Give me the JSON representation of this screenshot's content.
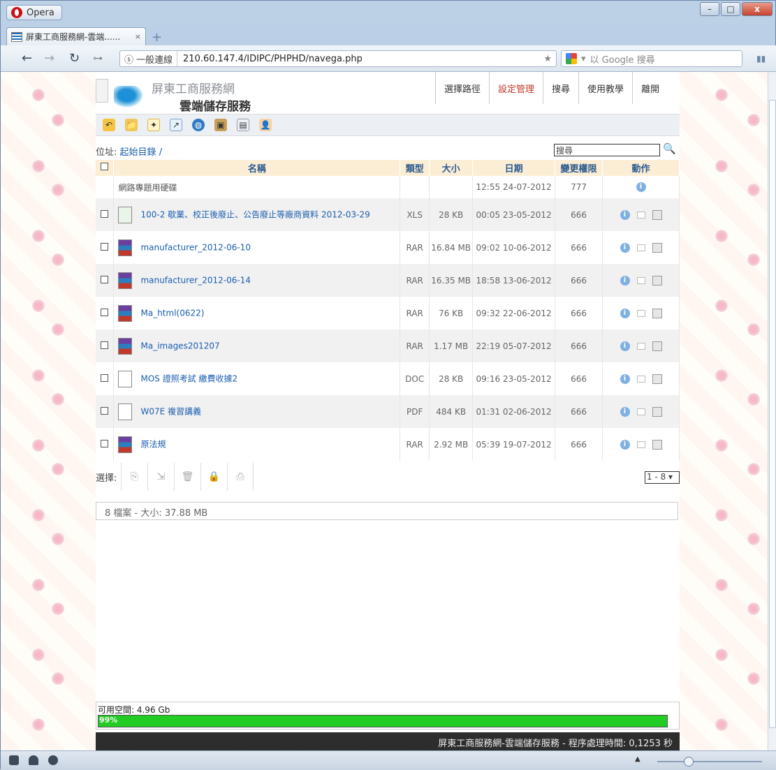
{
  "browser": {
    "app_name": "Opera",
    "tab_title": "屏東工商服務網-雲端......",
    "security_label": "一般連線",
    "url": "210.60.147.4/IDIPC/PHPHD/navega.php",
    "search_placeholder": "以 Google 搜尋"
  },
  "site": {
    "title_line1": "屏東工商服務網",
    "title_line2": "雲端儲存服務",
    "nav": [
      "選擇路徑",
      "設定管理",
      "搜尋",
      "使用教學",
      "離開"
    ],
    "active_nav_index": 1
  },
  "location": {
    "label": "位址:",
    "root_link": "起始目錄",
    "separator": "/",
    "search_value": "搜尋"
  },
  "table": {
    "columns": [
      "名稱",
      "類型",
      "大小",
      "日期",
      "變更權限",
      "動作"
    ],
    "parent_row": {
      "name": "網路專題用硬碟",
      "date": "12:55 24-07-2012",
      "perm": "777"
    },
    "rows": [
      {
        "icon": "xls-file-icon",
        "name": "100-2 歇業、校正後廢止、公告廢止等廠商資料 2012-03-29",
        "type": "XLS",
        "size": "28 KB",
        "date": "00:05 23-05-2012",
        "perm": "666"
      },
      {
        "icon": "rar-file-icon",
        "name": "manufacturer_2012-06-10",
        "type": "RAR",
        "size": "16.84 MB",
        "date": "09:02 10-06-2012",
        "perm": "666"
      },
      {
        "icon": "rar-file-icon",
        "name": "manufacturer_2012-06-14",
        "type": "RAR",
        "size": "16.35 MB",
        "date": "18:58 13-06-2012",
        "perm": "666"
      },
      {
        "icon": "rar-file-icon",
        "name": "Ma_html(0622)",
        "type": "RAR",
        "size": "76 KB",
        "date": "09:32 22-06-2012",
        "perm": "666"
      },
      {
        "icon": "rar-file-icon",
        "name": "Ma_images201207",
        "type": "RAR",
        "size": "1.17 MB",
        "date": "22:19 05-07-2012",
        "perm": "666"
      },
      {
        "icon": "doc-file-icon",
        "name": "MOS 證照考試 繳費收據2",
        "type": "DOC",
        "size": "28 KB",
        "date": "09:16 23-05-2012",
        "perm": "666"
      },
      {
        "icon": "pdf-file-icon",
        "name": "W07E 複習講義",
        "type": "PDF",
        "size": "484 KB",
        "date": "01:31 02-06-2012",
        "perm": "666"
      },
      {
        "icon": "rar-file-icon",
        "name": "原法規",
        "type": "RAR",
        "size": "2.92 MB",
        "date": "05:39 19-07-2012",
        "perm": "666"
      }
    ]
  },
  "selection": {
    "label": "選擇:",
    "pager_value": "1 - 8"
  },
  "status": {
    "summary": "8 檔案 - 大小: 37.88 MB"
  },
  "space": {
    "label": "可用空間: 4.96 Gb",
    "percent_label": "99%",
    "percent": 99
  },
  "footer": {
    "text": "屏東工商服務網-雲端儲存服務 - 程序處理時間: 0,1253 秒"
  },
  "colors": {
    "accent_link": "#1a5db0",
    "header_bg": "#fbeed5",
    "progress": "#22cc22",
    "active_nav": "#c0392b"
  }
}
